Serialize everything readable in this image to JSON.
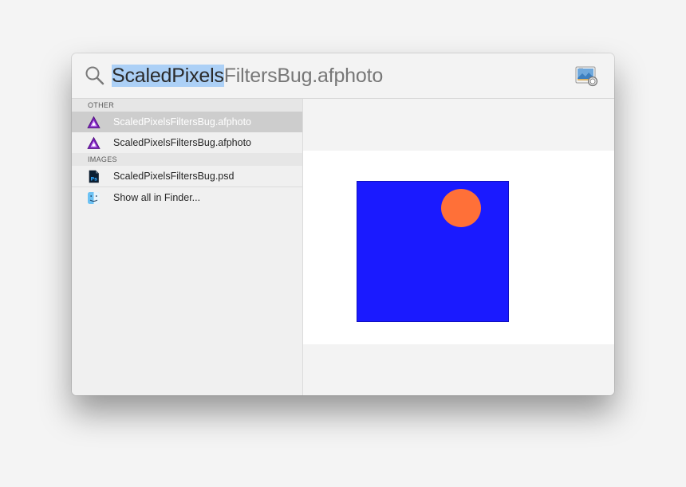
{
  "search": {
    "query_selected": "ScaledPixels",
    "query_rest": "FiltersBug.afphoto"
  },
  "sections": {
    "other": {
      "header": "OTHER",
      "items": [
        {
          "label": "ScaledPixelsFiltersBug.afphoto",
          "icon": "affinity-photo-icon",
          "selected": true
        },
        {
          "label": "ScaledPixelsFiltersBug.afphoto",
          "icon": "affinity-photo-icon",
          "selected": false
        }
      ]
    },
    "images": {
      "header": "IMAGES",
      "items": [
        {
          "label": "ScaledPixelsFiltersBug.psd",
          "icon": "photoshop-file-icon",
          "selected": false
        }
      ]
    },
    "finder": {
      "label": "Show all in Finder...",
      "icon": "finder-icon"
    }
  },
  "colors": {
    "selection_highlight": "#acd0f6",
    "selected_row": "#cdcdcd",
    "preview_square": "#1a1aff",
    "preview_circle": "#ff7038"
  }
}
